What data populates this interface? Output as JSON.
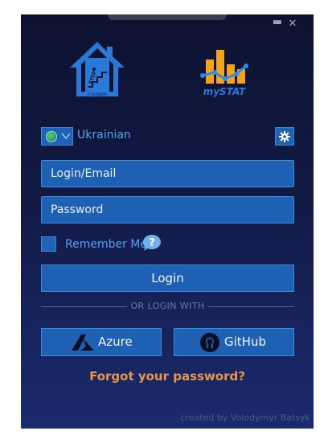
{
  "window": {
    "minimize_glyph": "▬",
    "close_glyph": "✕"
  },
  "logos": {
    "step_text": "STEP",
    "step_subtitle": "IT ACADEMY",
    "mystat_text": "mySTAT"
  },
  "language": {
    "label": "Ukrainian",
    "icon": "globe-icon",
    "dropdown_icon": "chevron-down-icon"
  },
  "settings": {
    "icon": "gear-icon"
  },
  "form": {
    "login_placeholder": "Login/Email",
    "password_placeholder": "Password",
    "remember_label": "Remember Me",
    "help_glyph": "?",
    "login_button": "Login"
  },
  "divider_text": "OR LOGIN WITH",
  "oauth": {
    "azure_label": "Azure",
    "github_label": "GitHub"
  },
  "forgot_password": "Forgot your password?",
  "credit": "created by Volodymyr Batsyk",
  "colors": {
    "accent": "#1d60b4",
    "link": "#4fa4f2",
    "forgot": "#e99545",
    "logo_blue": "#2b79d6",
    "logo_orange": "#f3a21a"
  }
}
